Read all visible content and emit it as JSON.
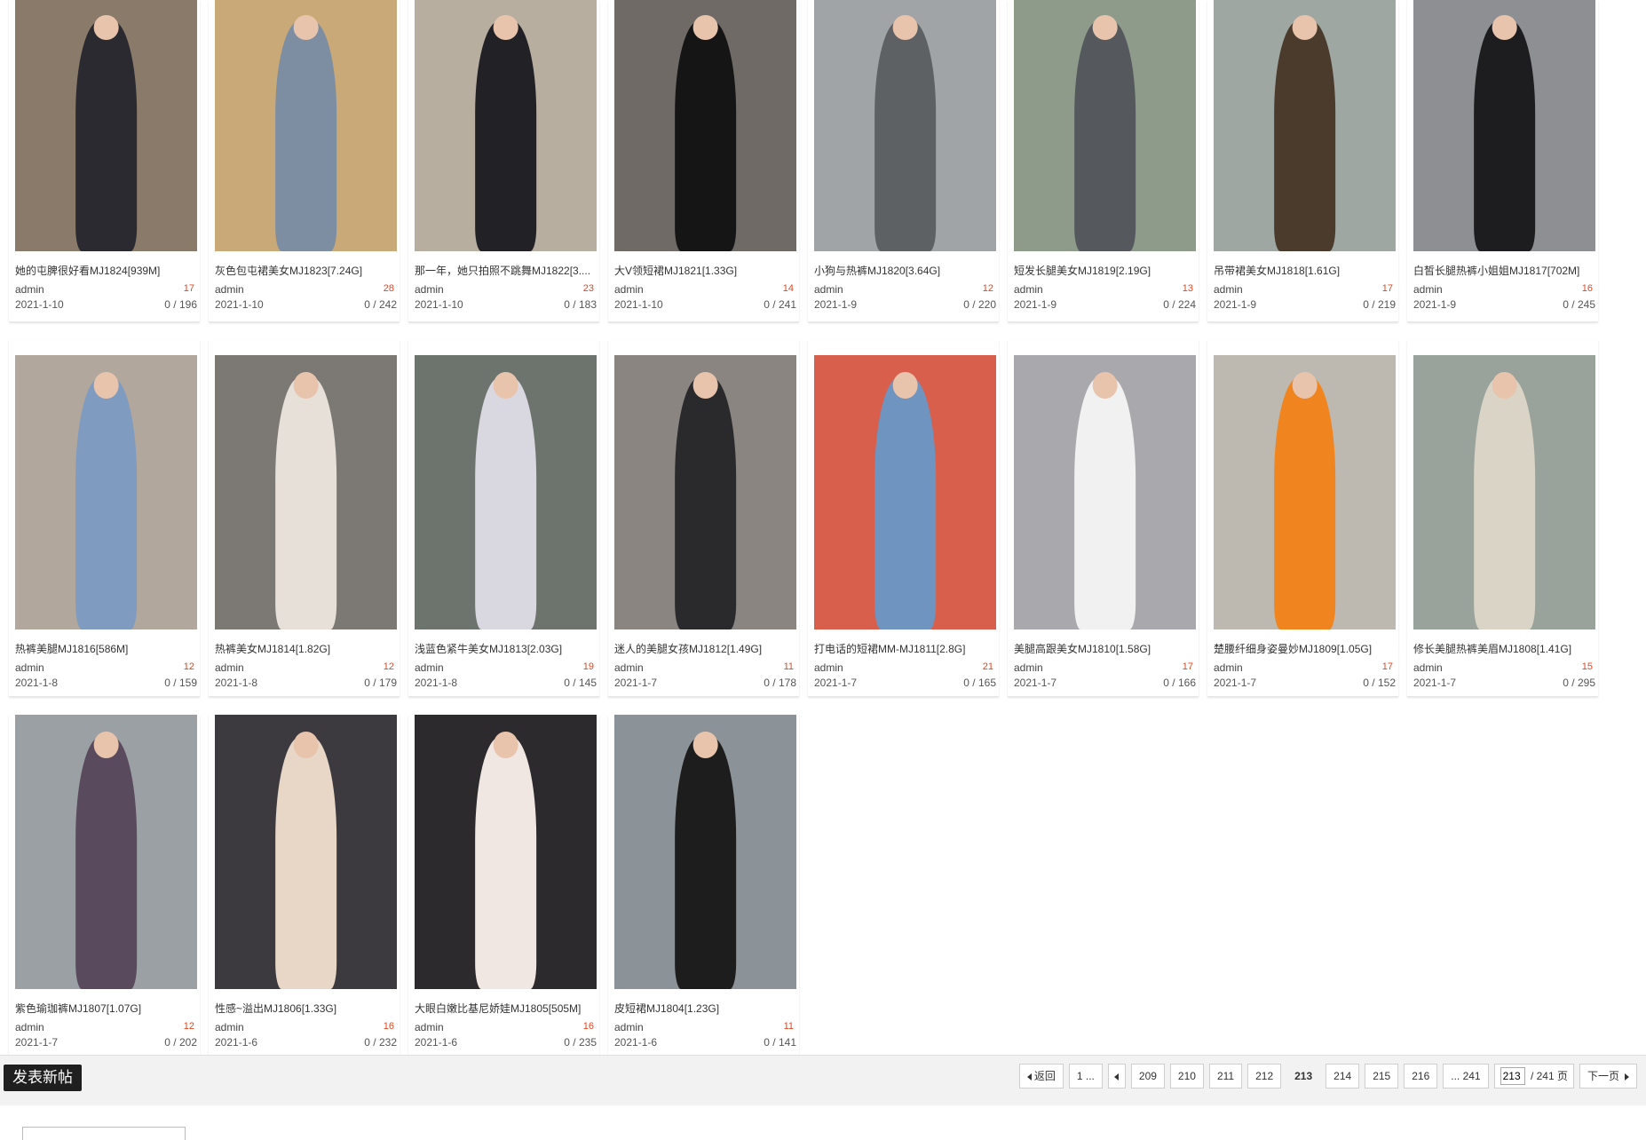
{
  "threads": [
    {
      "title": "她的屯脾很好看MJ1824[939M]",
      "author": "admin",
      "date": "2021-1-10",
      "replies": "17",
      "stats": "0 / 196",
      "img_bg": "#8a7a6a",
      "img_fg": "#2a2a30"
    },
    {
      "title": "灰色包屯裙美女MJ1823[7.24G]",
      "author": "admin",
      "date": "2021-1-10",
      "replies": "28",
      "stats": "0 / 242",
      "img_bg": "#c9a977",
      "img_fg": "#7d8ea3"
    },
    {
      "title": "那一年，她只拍照不跳舞MJ1822[3....",
      "author": "admin",
      "date": "2021-1-10",
      "replies": "23",
      "stats": "0 / 183",
      "img_bg": "#b8aea0",
      "img_fg": "#222226"
    },
    {
      "title": "大V领短裙MJ1821[1.33G]",
      "author": "admin",
      "date": "2021-1-10",
      "replies": "14",
      "stats": "0 / 241",
      "img_bg": "#6f6a66",
      "img_fg": "#151515"
    },
    {
      "title": "小狗与热裤MJ1820[3.64G]",
      "author": "admin",
      "date": "2021-1-9",
      "replies": "12",
      "stats": "0 / 220",
      "img_bg": "#a0a4a6",
      "img_fg": "#5d6164"
    },
    {
      "title": "短发长腿美女MJ1819[2.19G]",
      "author": "admin",
      "date": "2021-1-9",
      "replies": "13",
      "stats": "0 / 224",
      "img_bg": "#8e9b8a",
      "img_fg": "#55595e"
    },
    {
      "title": "吊带裙美女MJ1818[1.61G]",
      "author": "admin",
      "date": "2021-1-9",
      "replies": "17",
      "stats": "0 / 219",
      "img_bg": "#9ea7a1",
      "img_fg": "#4a3b2c"
    },
    {
      "title": "白皙长腿热裤小姐姐MJ1817[702M]",
      "author": "admin",
      "date": "2021-1-9",
      "replies": "16",
      "stats": "0 / 245",
      "img_bg": "#8d8f93",
      "img_fg": "#1d1d1f"
    },
    {
      "title": "热裤美腿MJ1816[586M]",
      "author": "admin",
      "date": "2021-1-8",
      "replies": "12",
      "stats": "0 / 159",
      "img_bg": "#b2a79c",
      "img_fg": "#7f9cc0"
    },
    {
      "title": "热裤美女MJ1814[1.82G]",
      "author": "admin",
      "date": "2021-1-8",
      "replies": "12",
      "stats": "0 / 179",
      "img_bg": "#7c7975",
      "img_fg": "#e6e0d8"
    },
    {
      "title": "浅蓝色紧牛美女MJ1813[2.03G]",
      "author": "admin",
      "date": "2021-1-8",
      "replies": "19",
      "stats": "0 / 145",
      "img_bg": "#6d746e",
      "img_fg": "#d9d7e0"
    },
    {
      "title": "迷人的美腿女孩MJ1812[1.49G]",
      "author": "admin",
      "date": "2021-1-7",
      "replies": "11",
      "stats": "0 / 178",
      "img_bg": "#8a8580",
      "img_fg": "#2a2a2c"
    },
    {
      "title": "打电话的短裙MM-MJ1811[2.8G]",
      "author": "admin",
      "date": "2021-1-7",
      "replies": "21",
      "stats": "0 / 165",
      "img_bg": "#d95f4d",
      "img_fg": "#6f94bf"
    },
    {
      "title": "美腿高跟美女MJ1810[1.58G]",
      "author": "admin",
      "date": "2021-1-7",
      "replies": "17",
      "stats": "0 / 166",
      "img_bg": "#a9a9ad",
      "img_fg": "#f1f1f1"
    },
    {
      "title": "楚腰纤细身姿曼妙MJ1809[1.05G]",
      "author": "admin",
      "date": "2021-1-7",
      "replies": "17",
      "stats": "0 / 152",
      "img_bg": "#bdb8b0",
      "img_fg": "#f0851f"
    },
    {
      "title": "修长美腿热裤美眉MJ1808[1.41G]",
      "author": "admin",
      "date": "2021-1-7",
      "replies": "15",
      "stats": "0 / 295",
      "img_bg": "#9aa39b",
      "img_fg": "#d9d4c6"
    },
    {
      "title": "紫色瑜珈裤MJ1807[1.07G]",
      "author": "admin",
      "date": "2021-1-7",
      "replies": "12",
      "stats": "0 / 202",
      "img_bg": "#9aa0a3",
      "img_fg": "#5a4a5e"
    },
    {
      "title": "性感~溢出MJ1806[1.33G]",
      "author": "admin",
      "date": "2021-1-6",
      "replies": "16",
      "stats": "0 / 232",
      "img_bg": "#3c3a3f",
      "img_fg": "#e8d6c7"
    },
    {
      "title": "大眼白嫩比基尼娇娃MJ1805[505M]",
      "author": "admin",
      "date": "2021-1-6",
      "replies": "16",
      "stats": "0 / 235",
      "img_bg": "#2c2a2d",
      "img_fg": "#f1e7e2"
    },
    {
      "title": "皮短裙MJ1804[1.23G]",
      "author": "admin",
      "date": "2021-1-6",
      "replies": "11",
      "stats": "0 / 141",
      "img_bg": "#8c9398",
      "img_fg": "#1d1d1d"
    }
  ],
  "toolbar": {
    "new_post_label": "发表新帖"
  },
  "pager": {
    "back_label": "返回",
    "first_label": "1 ...",
    "pages": [
      "209",
      "210",
      "211",
      "212",
      "213",
      "214",
      "215",
      "216"
    ],
    "current_page": "213",
    "last_label": "... 241",
    "input_value": "213",
    "total_label": "/ 241 页",
    "next_label": "下一页"
  }
}
